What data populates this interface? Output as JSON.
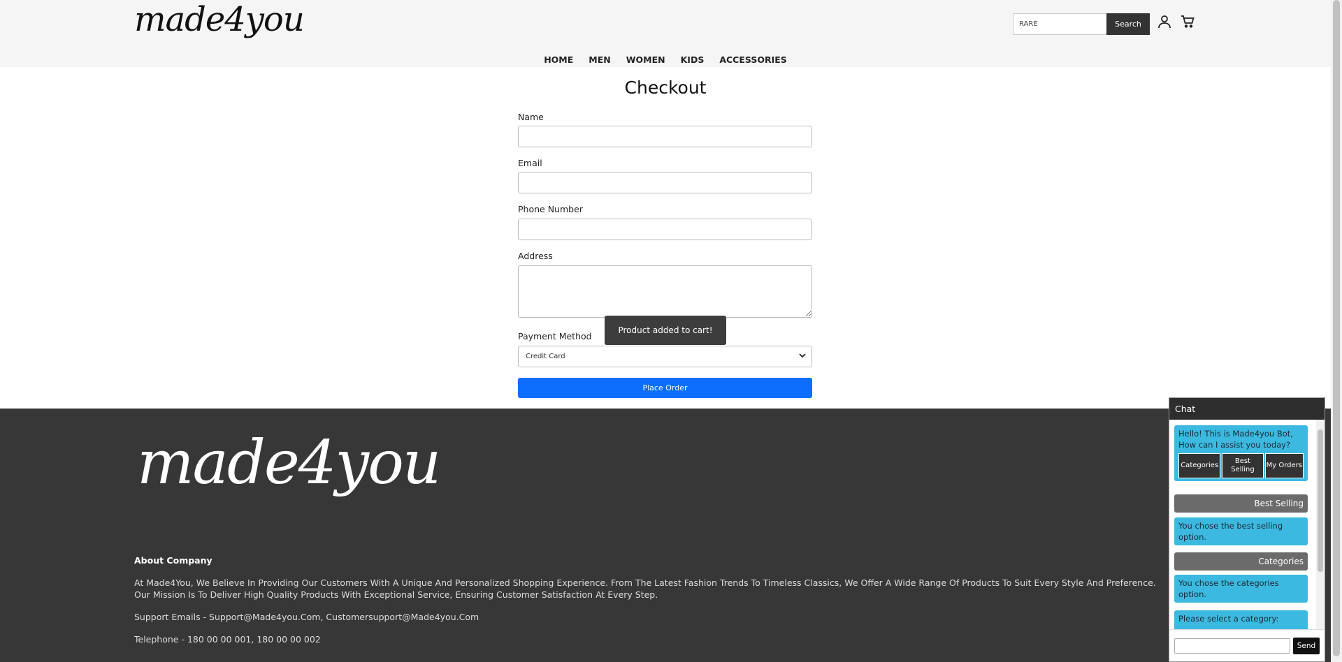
{
  "header": {
    "logo": "made4you",
    "search": {
      "value": "RARE",
      "button_label": "Search"
    },
    "icons": [
      "user-icon",
      "cart-icon"
    ]
  },
  "nav": [
    "HOME",
    "MEN",
    "WOMEN",
    "KIDS",
    "ACCESSORIES"
  ],
  "checkout": {
    "title": "Checkout",
    "labels": {
      "name": "Name",
      "email": "Email",
      "phone": "Phone Number",
      "address": "Address",
      "payment": "Payment Method"
    },
    "payment_selected": "Credit Card",
    "place_order": "Place Order"
  },
  "toast": "Product added to cart!",
  "footer": {
    "logo": "made4you",
    "about_heading": "About Company",
    "about_text": "At Made4You, We Believe In Providing Our Customers With A Unique And Personalized Shopping Experience. From The Latest Fashion Trends To Timeless Classics, We Offer A Wide Range Of Products To Suit Every Style And Preference. Our Mission Is To Deliver High Quality Products With Exceptional Service, Ensuring Customer Satisfaction At Every Step.",
    "support": "Support Emails - Support@Made4you.Com, Customersupport@Made4you.Com",
    "telephone": "Telephone - 180 00 00 001, 180 00 00 002"
  },
  "chat": {
    "title": "Chat",
    "greeting": "Hello! This is Made4you Bot, How can I assist you today?",
    "options": [
      "Categories",
      "Best Selling",
      "My Orders"
    ],
    "user_msg_1": "Best Selling",
    "bot_msg_1": "You chose the best selling option.",
    "user_msg_2": "Categories",
    "bot_msg_2": "You chose the categories option.",
    "bot_msg_3": "Please select a category:",
    "send_label": "Send"
  }
}
